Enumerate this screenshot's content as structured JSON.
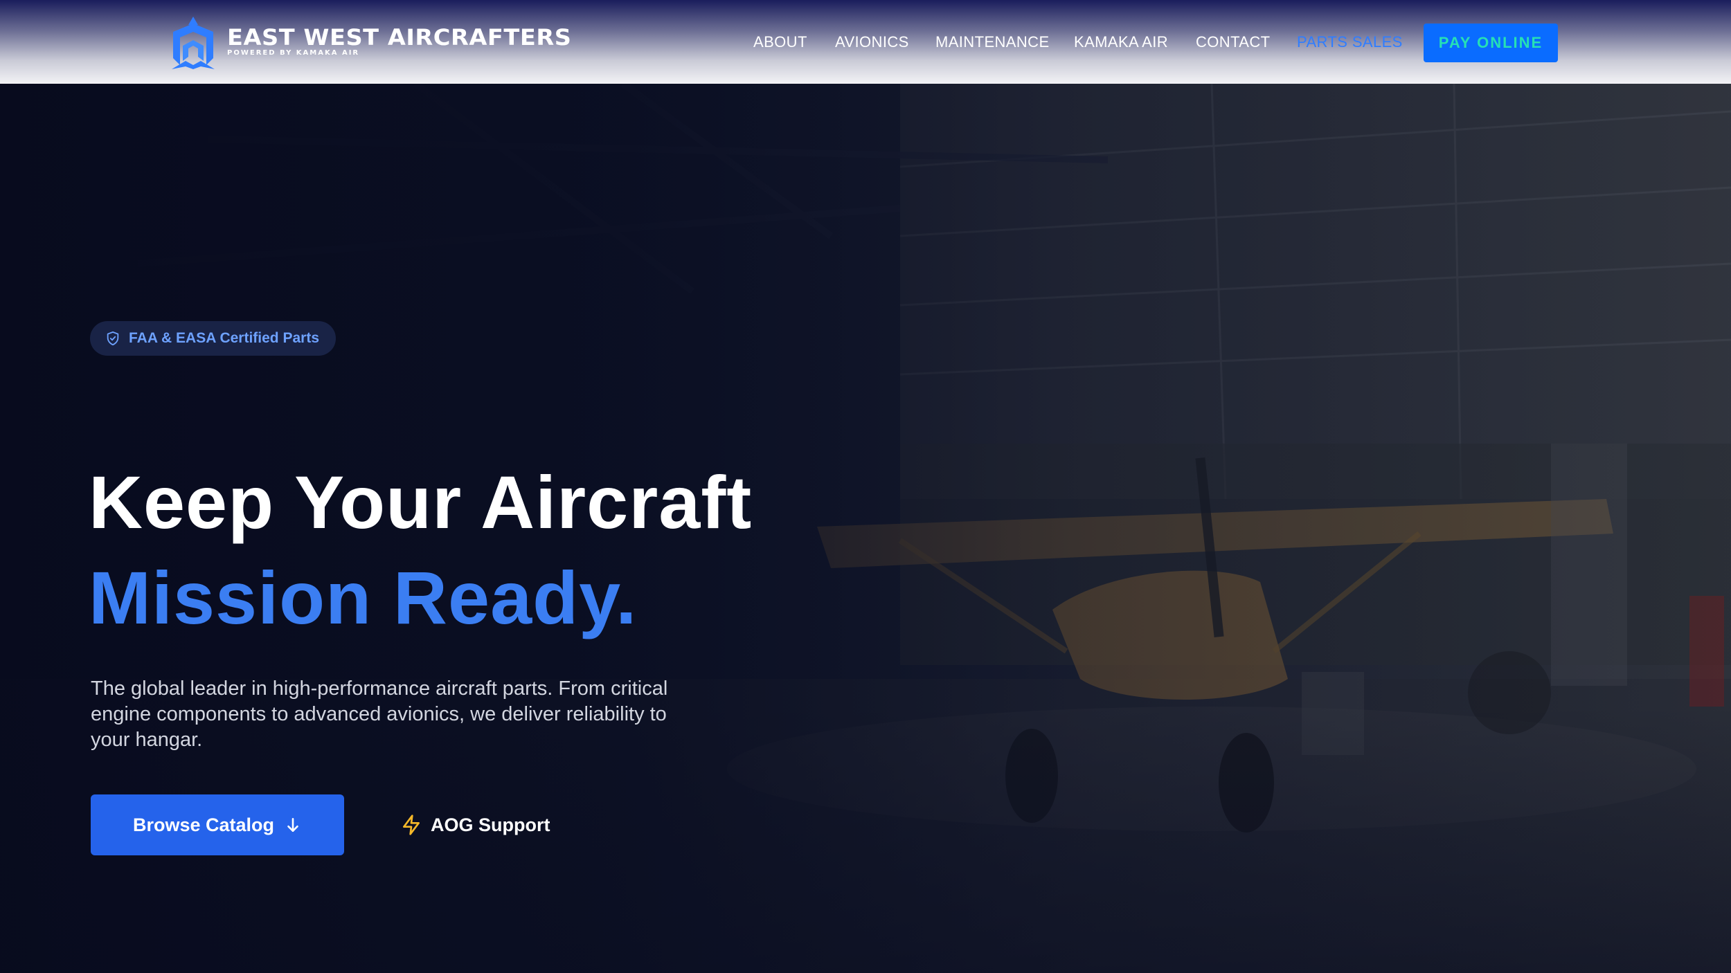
{
  "brand": {
    "name": "EAST WEST AIRCRAFTERS",
    "tagline": "POWERED BY KAMAKA AIR",
    "logo_icon": "wing-logo-icon",
    "accent_color": "#2f7dff"
  },
  "nav": {
    "items": [
      {
        "label": "ABOUT",
        "active": false
      },
      {
        "label": "AVIONICS",
        "active": false
      },
      {
        "label": "MAINTENANCE",
        "active": false
      },
      {
        "label": "KAMAKA AIR",
        "active": false
      },
      {
        "label": "CONTACT",
        "active": false
      },
      {
        "label": "PARTS SALES",
        "active": true
      }
    ],
    "cta_label": "PAY ONLINE",
    "cta_color": "#0a6cff"
  },
  "hero": {
    "badge": {
      "icon": "shield-check-icon",
      "text": "FAA & EASA Certified Parts"
    },
    "headline_line1": "Keep Your Aircraft",
    "headline_line2": "Mission Ready.",
    "headline_accent_color": "#3b7ef2",
    "description": "The global leader in high-performance aircraft parts. From critical engine components to advanced avionics, we deliver reliability to your hangar.",
    "primary_button": {
      "label": "Browse Catalog",
      "icon": "arrow-down-icon",
      "color": "#2563eb"
    },
    "secondary_link": {
      "label": "AOG Support",
      "icon": "lightning-bolt-icon",
      "icon_color": "#f5b829"
    }
  }
}
